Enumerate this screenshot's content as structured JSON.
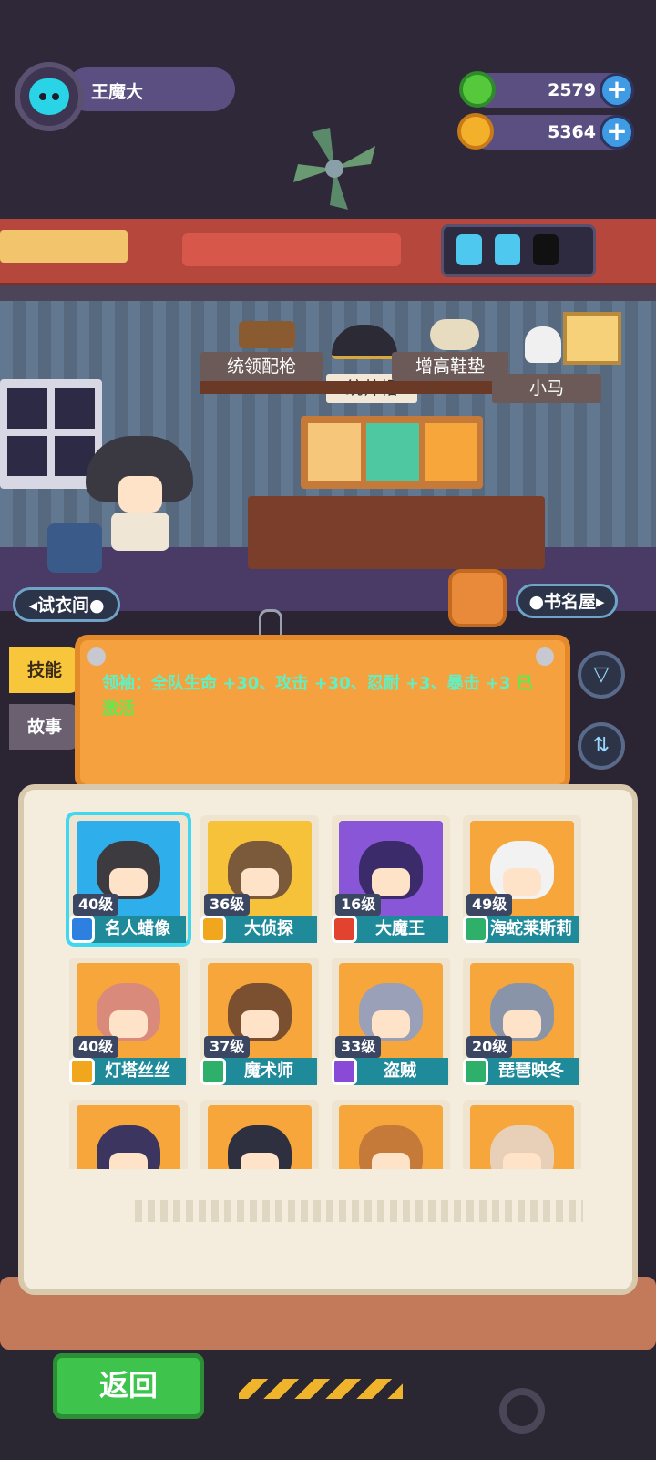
{
  "profile": {
    "name": "王魔大"
  },
  "currency": [
    {
      "icon": "green-donut-coin-icon",
      "value": "2579",
      "color": "#55c83c"
    },
    {
      "icon": "planet-coin-icon",
      "value": "5364",
      "color": "#f3b02b"
    }
  ],
  "items": [
    {
      "label": "统领配枪",
      "selected": false
    },
    {
      "label": "统帅帽",
      "selected": true
    },
    {
      "label": "增高鞋垫",
      "selected": false
    },
    {
      "label": "小马",
      "selected": false
    }
  ],
  "nav": {
    "left": "◂试衣间●",
    "right": "●书名屋▸"
  },
  "tabs": {
    "skill": "技能",
    "story": "故事"
  },
  "board": {
    "text": "领袖：全队生命 +30、攻击 +30、忍耐 +3、暴击 +3",
    "status": "已激活"
  },
  "characters": [
    {
      "level": "40级",
      "name": "名人蜡像",
      "badge": "#2d7fe0",
      "hair": "#3d3a40",
      "bg": "#2eaeea"
    },
    {
      "level": "36级",
      "name": "大侦探",
      "badge": "#f1a71d",
      "hair": "#7a5a3a",
      "bg": "#f6c23a"
    },
    {
      "level": "16级",
      "name": "大魔王",
      "badge": "#e2432f",
      "hair": "#3b2b6a",
      "bg": "#8a56d8"
    },
    {
      "level": "49级",
      "name": "海蛇莱斯莉",
      "badge": "#2fb06a",
      "hair": "#f2f2f2",
      "bg": "#f6a63a"
    },
    {
      "level": "40级",
      "name": "灯塔丝丝",
      "badge": "#f1a71d",
      "hair": "#d98a7a",
      "bg": "#f6a63a"
    },
    {
      "level": "37级",
      "name": "魔术师",
      "badge": "#2fb06a",
      "hair": "#7a5030",
      "bg": "#f6a63a"
    },
    {
      "level": "33级",
      "name": "盗贼",
      "badge": "#8a4ad8",
      "hair": "#9aa0b8",
      "bg": "#f6a63a"
    },
    {
      "level": "20级",
      "name": "琵琶映冬",
      "badge": "#2fb06a",
      "hair": "#8a94a8",
      "bg": "#f6a63a"
    },
    {
      "level": "",
      "name": "",
      "badge": "",
      "hair": "#3b3560",
      "bg": "#f6a63a"
    },
    {
      "level": "",
      "name": "",
      "badge": "",
      "hair": "#2e3040",
      "bg": "#f6a63a"
    },
    {
      "level": "",
      "name": "",
      "badge": "",
      "hair": "#c67a3a",
      "bg": "#f6a63a"
    },
    {
      "level": "",
      "name": "",
      "badge": "",
      "hair": "#e8d0b8",
      "bg": "#f6a63a"
    }
  ],
  "back_button": "返回"
}
